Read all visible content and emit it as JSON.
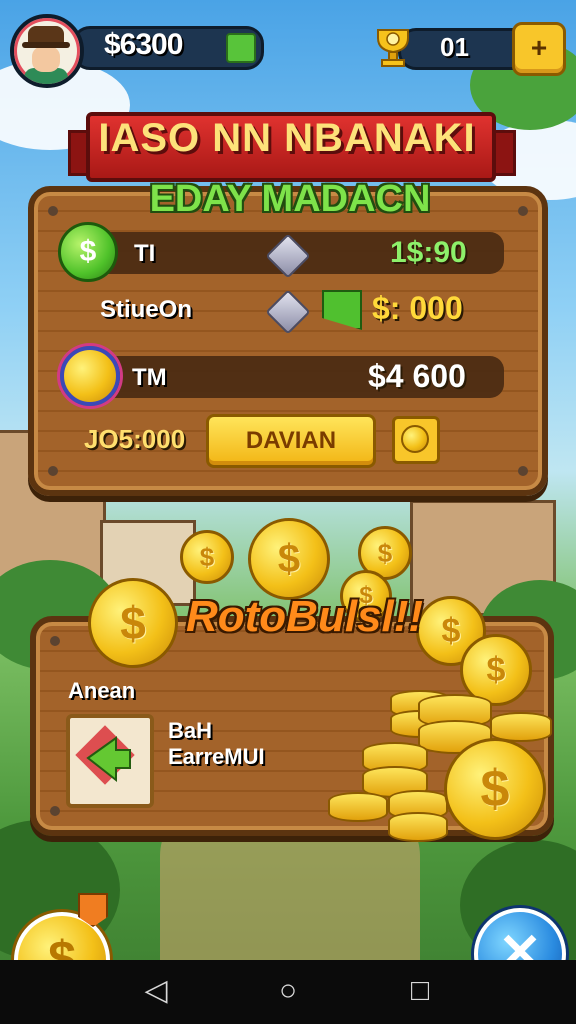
{
  "hud": {
    "money": "$6300",
    "gems": "01",
    "plus_label": "+"
  },
  "header": {
    "title": "IASO NN NBANAKI",
    "subtitle": "EDAY MADACN"
  },
  "rewards_panel": {
    "rows": [
      {
        "label": "TI",
        "value": "1$:90",
        "value_color": "#8df06a"
      },
      {
        "label": "StiueOn",
        "value": "$: 000",
        "value_color": "#ffd93a"
      },
      {
        "label": "TM",
        "value": "$4 600",
        "value_color": "#ffffff"
      }
    ],
    "total": "JO5:000",
    "action_button": "DAVIAN"
  },
  "bonus_panel": {
    "banner": "RotoBulsl!!",
    "section_label": "Anean",
    "item_line1": "BaH",
    "item_line2": "EarreMUI"
  },
  "icons": {
    "dollar": "$",
    "close": "✕",
    "nav_back": "◁",
    "nav_home": "○",
    "nav_recent": "□"
  },
  "colors": {
    "wood": "#a3632a",
    "ribbon": "#e0322f",
    "coin": "#f3c018",
    "accent_green": "#7ee34a",
    "close_blue": "#2a8be0"
  }
}
